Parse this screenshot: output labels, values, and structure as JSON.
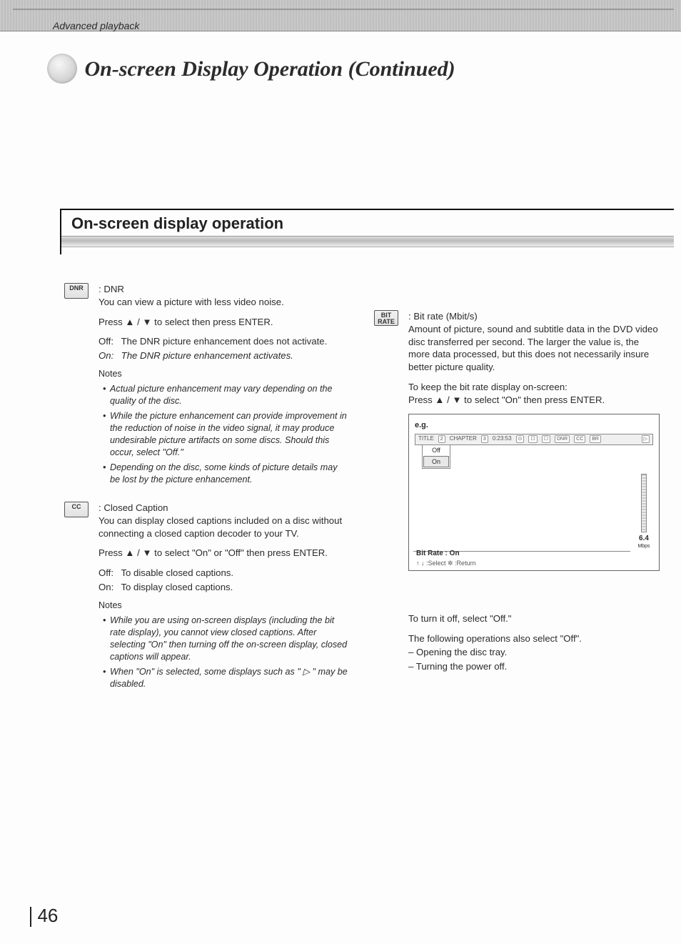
{
  "header": {
    "section_label": "Advanced playback"
  },
  "title": "On-screen Display Operation (Continued)",
  "section_heading": "On-screen display operation",
  "dnr": {
    "icon": "DNR",
    "heading": "DNR",
    "intro": "You can view a picture with less video noise.",
    "instruction_pre": "Press ",
    "instruction_mid": " / ",
    "instruction_post": " to select then press ENTER.",
    "off_label": "Off:",
    "off_text": "The DNR picture enhancement does not activate.",
    "on_label": "On:",
    "on_text": "The DNR picture enhancement activates.",
    "notes_label": "Notes",
    "notes": [
      "Actual picture enhancement may vary depending on the quality of the disc.",
      "While the picture enhancement can provide improvement in the reduction of noise in the video signal, it may produce undesirable picture artifacts on some discs. Should this occur, select \"Off.\"",
      "Depending on the disc, some kinds of picture details may be lost by the picture enhancement."
    ]
  },
  "cc": {
    "icon": "CC",
    "heading": "Closed Caption",
    "intro": "You can display closed captions included on a disc without connecting a closed caption decoder to your TV.",
    "instruction_pre": "Press ",
    "instruction_mid": " / ",
    "instruction_post": " to select \"On\" or \"Off\" then press ENTER.",
    "off_label": "Off:",
    "off_text": "To disable closed captions.",
    "on_label": "On:",
    "on_text": "To display closed captions.",
    "notes_label": "Notes",
    "notes": [
      "While you are using on-screen displays (including the bit rate display), you cannot view closed captions. After selecting \"On\" then turning off the on-screen display, closed captions will appear.",
      "When \"On\" is selected, some displays such as \" ▷ \" may be disabled."
    ]
  },
  "bitrate": {
    "icon_line1": "BIT",
    "icon_line2": "RATE",
    "heading": "Bit rate (Mbit/s)",
    "intro": "Amount of picture, sound and subtitle data in the DVD video disc transferred per second. The larger the value is, the more data processed, but this does not necessarily insure better picture quality.",
    "keep_line": "To keep the bit rate display on-screen:",
    "instruction_pre": "Press ",
    "instruction_mid": " / ",
    "instruction_post": " to select \"On\" then press ENTER.",
    "turn_off": "To turn it off, select \"Off.\"",
    "also_off": "The following operations also select \"Off\".",
    "also_off_items": [
      "– Opening the disc tray.",
      "– Turning the power off."
    ]
  },
  "osd": {
    "eg_label": "e.g.",
    "top_title": "TITLE",
    "top_title_num": "2",
    "top_chapter": "CHAPTER",
    "top_chapter_num": "3",
    "top_time": "0:23:53",
    "menu_off": "Off",
    "menu_on": "On",
    "rate_value": "6.4",
    "rate_unit": "Mbps",
    "status": "Bit Rate : On",
    "help": "↑ ↓ :Select   ✲ :Return"
  },
  "page_number": "46"
}
